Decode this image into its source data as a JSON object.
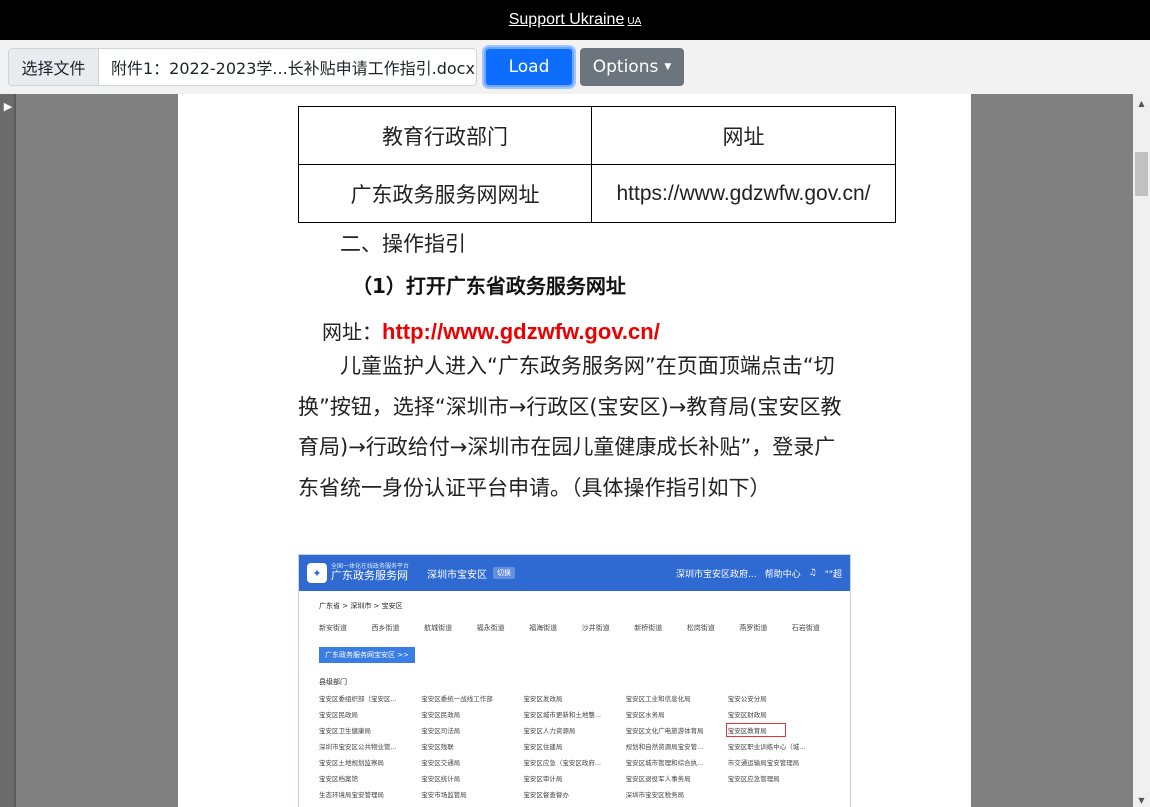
{
  "banner": {
    "text": "Support Ukraine",
    "suffix": "UA"
  },
  "toolbar": {
    "file_button": "选择文件",
    "file_name": "附件1：2022-2023学...长补贴申请工作指引.docx",
    "load": "Load",
    "options": "Options"
  },
  "sidebar": {
    "toggle_icon": "▶"
  },
  "document": {
    "table": {
      "headers": [
        "教育行政部门",
        "网址"
      ],
      "rows": [
        [
          "广东政务服务网网址",
          "https://www.gdzwfw.gov.cn/"
        ]
      ]
    },
    "section_heading": "二、操作指引",
    "step_heading": "（1）打开广东省政务服务网址",
    "url_label": "网址：",
    "url_value": "http://www.gdzwfw.gov.cn/",
    "paragraph": "儿童监护人进入“广东政务服务网”在页面顶端点击“切换”按钮，选择“深圳市→行政区(宝安区)→教育局(宝安区教育局)→行政给付→深圳市在园儿童健康成长补贴”，登录广东省统一身份认证平台申请。（具体操作指引如下）"
  },
  "screenshot": {
    "logo_small": "全国一体化在线政务服务平台",
    "brand": "广东政务服务网",
    "city": "深圳市宝安区",
    "switch": "切换",
    "right_links": [
      "深圳市宝安区政府...",
      "帮助中心",
      "\"\"超"
    ],
    "breadcrumb": "广东省  >  深圳市  >  宝安区",
    "streets": [
      "新安街道",
      "西乡街道",
      "航城街道",
      "福永街道",
      "福海街道",
      "沙井街道",
      "新桥街道",
      "松岗街道",
      "燕罗街道",
      "石岩街道"
    ],
    "button": "广东政务服务网宝安区 >>",
    "dept_title": "县级部门",
    "departments": [
      "宝安区委组织部（宝安区...",
      "宝安区委统一战线工作部",
      "宝安区发改局",
      "宝安区工业和信息化局",
      "宝安公安分局",
      "宝安区民政局",
      "宝安区民政局",
      "宝安区城市更新和土地整...",
      "宝安区水务局",
      "宝安区财政局",
      "宝安区卫生健康局",
      "宝安区司法局",
      "宝安区人力资源局",
      "宝安区文化广电旅游体育局",
      "宝安区教育局",
      "深圳市宝安区公共物业管...",
      "宝安区残联",
      "宝安区住建局",
      "规划和自然资源局宝安管...",
      "宝安区职业训练中心（城...",
      "宝安区土地规划监察局",
      "宝安区交通局",
      "宝安区应急（宝安区政府...",
      "宝安区城市管理和综合执...",
      "市交通运输局宝安管理局",
      "宝安区档案馆",
      "宝安区统计局",
      "宝安区审计局",
      "宝安区退役军人事务局",
      "宝安区应急管理局",
      "生态环境局宝安管理局",
      "宝安市场监管局",
      "宝安区督查督办",
      "深圳市宝安区税务局",
      ""
    ],
    "highlight_index": 14
  }
}
